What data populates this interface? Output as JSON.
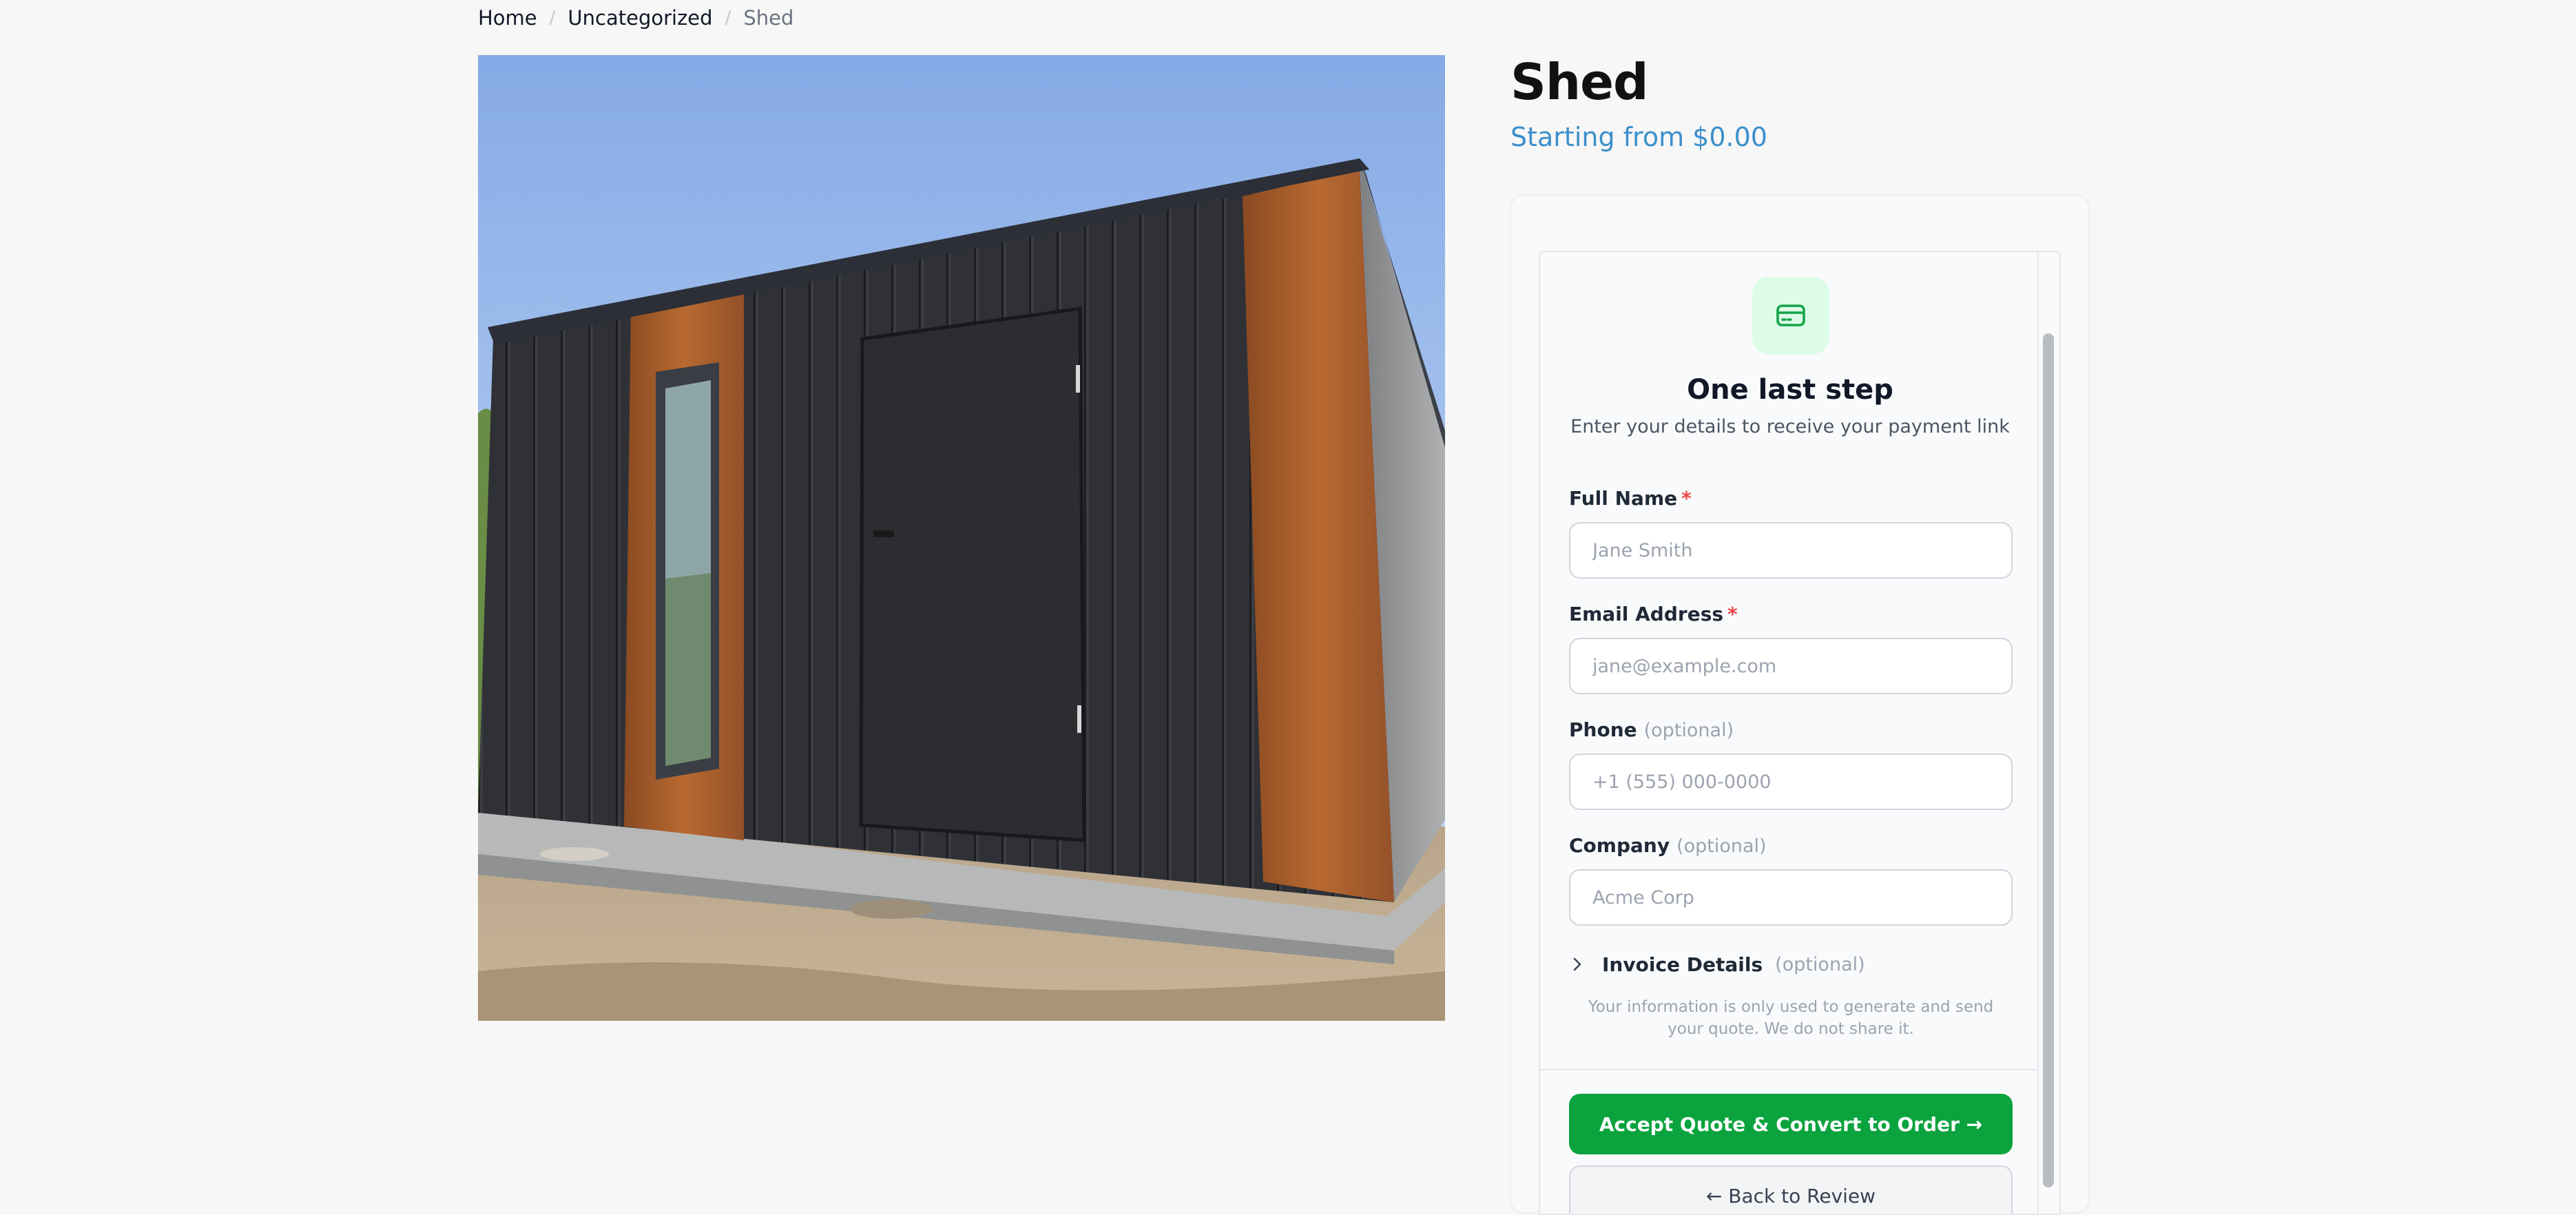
{
  "breadcrumb": {
    "items": [
      "Home",
      "Uncategorized"
    ],
    "separator": "/",
    "current": "Shed"
  },
  "product": {
    "title": "Shed",
    "price_text": "Starting from $0.00",
    "image_icon": "shed-photo"
  },
  "form": {
    "icon": "credit-card-icon",
    "heading": "One last step",
    "subheading": "Enter your details to receive your payment link",
    "required_mark": "*",
    "fields": {
      "full_name": {
        "label": "Full Name",
        "placeholder": "Jane Smith",
        "value": ""
      },
      "email": {
        "label": "Email Address",
        "placeholder": "jane@example.com",
        "value": ""
      },
      "phone": {
        "label": "Phone",
        "optional": "(optional)",
        "placeholder": "+1 (555) 000-0000",
        "value": ""
      },
      "company": {
        "label": "Company",
        "optional": "(optional)",
        "placeholder": "Acme Corp",
        "value": ""
      }
    },
    "invoice": {
      "label": "Invoice Details",
      "optional": "(optional)",
      "icon": "chevron-right-icon"
    },
    "privacy_note": "Your information is only used to generate and send your quote. We do not share it.",
    "primary_button": "Accept Quote & Convert to Order →",
    "secondary_button": "← Back to Review"
  },
  "colors": {
    "accent_green": "#0aa33e",
    "price_blue": "#3b8fcb",
    "required_red": "#ef4444",
    "badge_bg": "#dcfce7"
  }
}
